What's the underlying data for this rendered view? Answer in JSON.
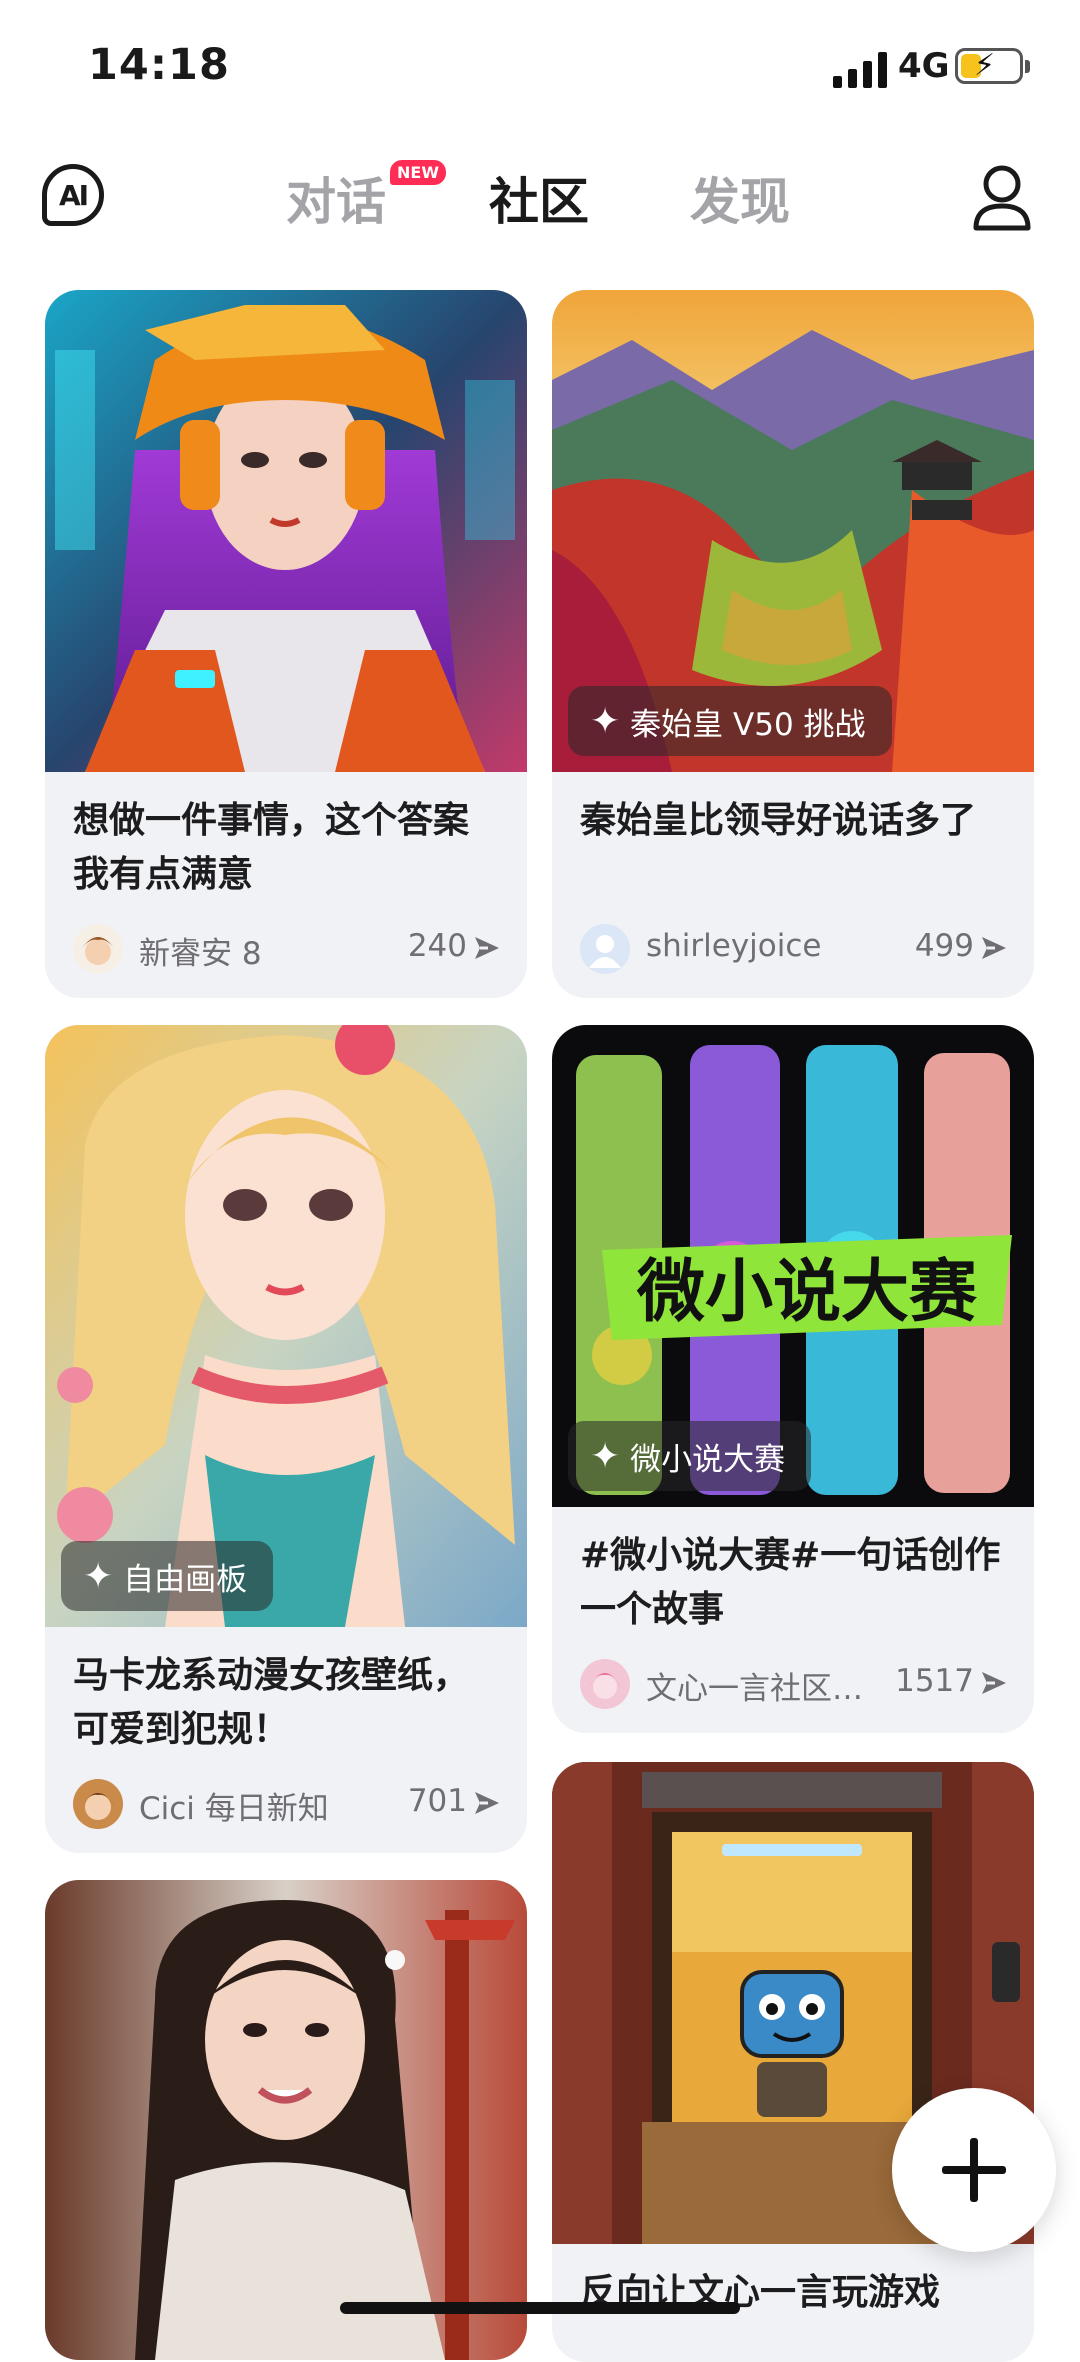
{
  "status": {
    "time": "14:18",
    "network": "4G"
  },
  "nav": {
    "logo": "AI",
    "tabs": [
      {
        "label": "对话",
        "badge": "NEW"
      },
      {
        "label": "社区",
        "active": true
      },
      {
        "label": "发现"
      }
    ]
  },
  "cards": [
    {
      "title": "想做一件事情，这个答案我有点满意",
      "author": "新睿安 8",
      "count": "240"
    },
    {
      "tag": "秦始皇 V50 挑战",
      "title": "秦始皇比领导好说话多了",
      "author": "shirleyjoice",
      "count": "499"
    },
    {
      "tag": "自由画板",
      "title": "马卡龙系动漫女孩壁纸，可爱到犯规！",
      "author": "Cici 每日新知",
      "count": "701"
    },
    {
      "tag": "微小说大赛",
      "poster_text": "微小说大赛",
      "title": "#微小说大赛#一句话创作一个故事",
      "author": "文心一言社区…",
      "count": "1517"
    },
    {
      "title": "反向让文心一言玩游戏"
    }
  ],
  "colors": {
    "accent_badge": "#ff2d55",
    "card_bg": "#f1f2f6",
    "battery": "#f6c21b"
  }
}
